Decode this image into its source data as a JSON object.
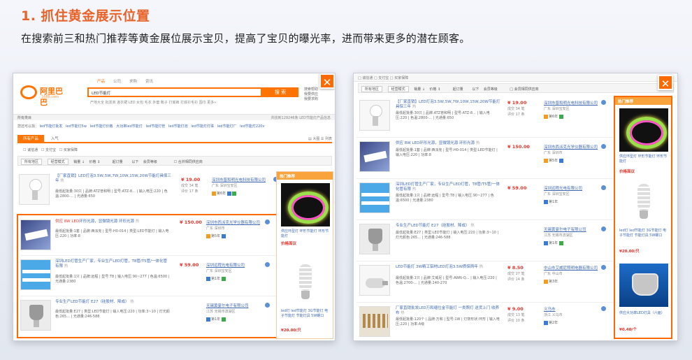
{
  "heading": {
    "title": "1. 抓住黄金展示位置",
    "subtitle": "在搜索前三和热门推荐等黄金展位展示宝贝，提高了宝贝的曝光率，进而带来更多的潜在顾客。"
  },
  "left_screenshot": {
    "close": "✕",
    "logo": {
      "text": "阿里巴巴",
      "sub": "1688.com"
    },
    "search_tabs": [
      "产品",
      "公司",
      "求购",
      "资讯"
    ],
    "search_value": "LED节能灯",
    "search_button": "搜 索",
    "side_links": [
      "搜索帮助",
      "我要供应",
      "我要求购"
    ],
    "hotwords": "产地大全  批发商  连衣裙  LED  女包  毛衣  外套  靴子  打底裤  打底衫毛衫  围巾  更多»",
    "crumb": "所有类目",
    "crumb_right": "共找到129246条 LED节能灯产品信息",
    "filter_label": "您还可以找：",
    "filter_links": [
      "led节能灯批发",
      "led节能灯5w",
      "led节能灯价格",
      "大功率led节能灯",
      "led节能灯管",
      "led节能灯泡",
      "led节能灯灯珠",
      "led节能灯厂",
      "led节能灯220v"
    ],
    "tabs": [
      "所有产品",
      "入气"
    ],
    "tab_right": "▤ 大图   ☰ 列表",
    "checks": [
      "诚信通",
      "支付宝",
      "买家保障"
    ],
    "sortbar": {
      "selects": [
        "所有地区",
        "经营模式"
      ],
      "items": [
        "销量",
        "价格",
        "起订量",
        "以下",
        "会员等级",
        "合并相同供应商"
      ]
    },
    "rows": [
      {
        "thumb": "lamp",
        "title_red": "",
        "title": "【厂家直销】LED灯泡3.5W,5W,7W,10W,15W,20W节能灯具保三年",
        "tag": "热",
        "spec": "最低起批量:30只 | 品牌:ATZ普和明 | 型号:ATZ-8... | 输入电压:220 | 色温:2800-... | 光通量:650",
        "price": "¥ 19.00",
        "price_sub": "成交 34 笔",
        "price_sub2": "评价 17 条",
        "company": "深圳市普和明光电科技有限公司",
        "location": "广东 深圳宝安区",
        "badge_text": "第6年",
        "in_box": false
      },
      {
        "thumb": "strip",
        "title_red": "供应 8W LED",
        "title": "环形光源，显微镜光源 环形光源",
        "tag": "热",
        "spec": "最低起批量:1套 | 品牌:西派克 | 型号:H0-014 | 类型:LED节能灯 | 输入电压:220 | 功率:8",
        "price": "¥ 150.00",
        "price_sub": "",
        "price_sub2": "",
        "company": "深圳市西派克光学仪器有限公司",
        "location": "广东 深圳市",
        "badge_text": "第5年",
        "in_box": true
      },
      {
        "thumb": "tube",
        "title_red": "",
        "title": "深圳LED灯管生产厂家，专业生产LED灯管，T8管/T5管/一体化管有限",
        "tag": "热",
        "spec": "最低起批量:1只 | 品牌:远程 | 型号:T8 | 输入电压:90~277 | 色温:6500 | 光通量:2380",
        "price": "¥ 59.00",
        "price_sub": "",
        "price_sub2": "",
        "company": "深圳远程光电有限公司",
        "location": "广东 深圳宝安区",
        "badge_text": "第1年",
        "in_box": true
      },
      {
        "thumb": "spot",
        "title_red": "",
        "title": "专业生产LED节能灯 E27（硅胶材、降成）",
        "tag": "热",
        "spec": "最低起批量:E27 | 类型:LED节能灯 | 输入电压:220 | 功率:3~10 | 灯光颜色:265... | 光通量:246-588",
        "price": "",
        "price_sub": "",
        "price_sub2": "",
        "company": "无锡黄宴尔电子有限公司",
        "location": "江苏 无锡市滨湖区",
        "badge_text": "第1年",
        "in_box": true
      }
    ],
    "hot": {
      "head": "热门推荐",
      "items": [
        {
          "image": "ring",
          "caption": "供应环型灯 环形节能灯 环形节能灯",
          "price": "价格面议"
        },
        {
          "image": "cfl",
          "caption": "led灯 led节能灯 3G节能灯 电子节能灯 节能灯具 5W螺口",
          "price": "¥20.00/只"
        }
      ]
    }
  },
  "right_screenshot": {
    "close": "✕",
    "topbar": "□ 诚信通    □ 支付宝    □ 买家保障",
    "topbar_right": "□ 会员相同供应商",
    "sortbar": {
      "selects": [
        "所有地区",
        "经营模式"
      ],
      "items": [
        "销量",
        "价格",
        "起订量",
        "以下",
        "会员等级"
      ]
    },
    "rows": [
      {
        "thumb": "lamp",
        "title": "【厂家直销】LED灯泡3.5W,5W,7W,10W,15W,20W节能灯具保三年",
        "tag": "热",
        "spec": "最低起批量:30只 | 品牌:ATZ普和明 | 型号:ATZ-8... | 输入电压:220 | 色温:2800-... | 光通量:650",
        "price": "¥ 19.00",
        "price_sub": "成交 34 笔",
        "price_sub2": "评价 17 条",
        "company": "深圳市普和明光电科技有限公司",
        "location": "广东 深圳宝安区",
        "badge_text": "第6年"
      },
      {
        "thumb": "strip",
        "title": "供应 8W LED环形光源，显微镜光源 环形光源",
        "tag": "热",
        "spec": "最低起批量:1套 | 品牌:西派克 | 型号:H0-014 | 类型:LED节能灯 | 输入电压:220 | 功率:8",
        "price": "¥ 150.00",
        "price_sub": "",
        "price_sub2": "",
        "company": "深圳市西派克光学仪器有限公司",
        "location": "广东 深圳市",
        "badge_text": "第5年"
      },
      {
        "thumb": "tube",
        "title": "深圳LED灯管生产厂家，专业生产LED灯管，T8管/T5管/一体化管有限",
        "tag": "热",
        "spec": "最低起批量:1只 | 品牌:远程 | 型号:T8 | 输入电压:90~277 | 色温:6500 | 光通量:2380",
        "price": "¥ 59.00",
        "price_sub": "",
        "price_sub2": "",
        "company": "深圳远程光电有限公司",
        "location": "广东 深圳宝安区",
        "badge_text": "第1年"
      },
      {
        "thumb": "spot",
        "title": "专业生产LED节能灯 E27（硅胶材、降成）",
        "tag": "热",
        "spec": "最低起批量:E27 | 类型:LED节能灯 | 输入电压:220 | 功率:3~10 | 灯光颜色:265... | 光通量:246-588",
        "price": "",
        "price_sub": "",
        "price_sub2": "",
        "company": "无锡黄宴尔电子有限公司",
        "location": "江苏 无锡市滨湖区",
        "badge_text": "第1年"
      },
      {
        "thumb": "bulb",
        "title": "LED节能灯 3W精工铝材LED灯泡3.5W质保两年",
        "tag": "热",
        "spec": "最低起批量:1只 | 品牌:艾威尼 | 型号:AWN-Q... | 输入电压:220 | 色温:2700-... | 光通量:240-270",
        "price": "¥ 8.50",
        "price_sub": "成交 27 笔",
        "price_sub2": "评价 14 条",
        "company": "中山市艾威尼照明电器有限公司",
        "location": "广东 中山市",
        "badge_text": "第3年"
      },
      {
        "thumb": "mini",
        "title": "厂家直销批发LED万和缩位金节能灯 一类照灯 送货上门 收养布",
        "tag": "热",
        "spec": "最低起批量:120个 | 品牌:万和 | 型号:1W | 灯饰形状:环形 | 输入电压:220 | 功率:A级",
        "price": "¥ 9.00",
        "price_sub": "成交 13 笔",
        "price_sub2": "评价 10 条",
        "company": "义乌市",
        "location": "浙江 义乌市",
        "badge_text": "第2年"
      }
    ],
    "hot": {
      "head": "热门推荐",
      "items": [
        {
          "image": "ring",
          "caption": "供应环型灯 环形节能灯 环形节能灯",
          "price": "价格面议"
        },
        {
          "image": "cfl",
          "caption": "led灯 led节能灯 3G节能灯 电子节能灯 节能灯具 5W螺口",
          "price": "¥20.00/只"
        },
        {
          "image": "spot",
          "caption": "供应大功率LED灯具（六面）",
          "price": "¥0.40/个"
        }
      ]
    }
  }
}
